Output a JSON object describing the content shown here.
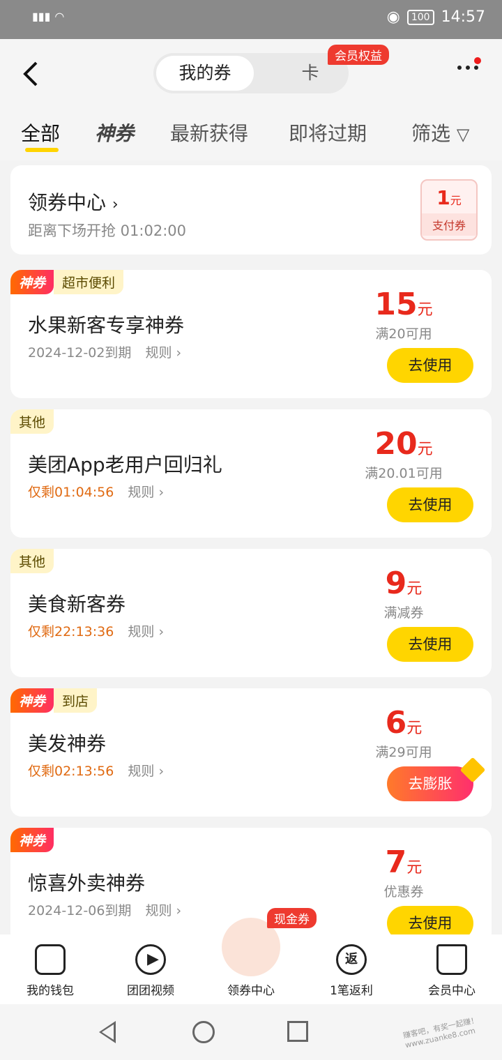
{
  "status": {
    "time": "14:57",
    "battery": "100"
  },
  "header": {
    "tab_active": "我的券",
    "tab_other": "卡",
    "vip_badge": "会员权益"
  },
  "filters": {
    "items": [
      "全部",
      "神券",
      "最新获得",
      "即将过期",
      "筛选"
    ]
  },
  "coupon_center": {
    "title": "领券中心",
    "subtitle": "距离下场开抢 01:02:00",
    "mini_amount": "1",
    "mini_unit": "元",
    "mini_label": "支付券"
  },
  "coupons": [
    {
      "tag_shen": "神券",
      "category": "超市便利",
      "name": "水果新客专享神券",
      "meta": "2024-12-02到期",
      "rule": "规则",
      "amount": "15",
      "unit": "元",
      "cond": "满20可用",
      "button": "去使用"
    },
    {
      "category": "其他",
      "name": "美团App老用户回归礼",
      "meta": "仅剩01:04:56",
      "rule": "规则",
      "amount": "20",
      "unit": "元",
      "cond": "满20.01可用",
      "button": "去使用"
    },
    {
      "category": "其他",
      "name": "美食新客券",
      "meta": "仅剩22:13:36",
      "rule": "规则",
      "amount": "9",
      "unit": "元",
      "cond": "满减券",
      "button": "去使用"
    },
    {
      "tag_shen": "神券",
      "category": "到店",
      "name": "美发神券",
      "meta": "仅剩02:13:56",
      "rule": "规则",
      "amount": "6",
      "unit": "元",
      "cond": "满29可用",
      "button": "去膨胀"
    },
    {
      "tag_shen": "神券",
      "name": "惊喜外卖神券",
      "meta": "2024-12-06到期",
      "rule": "规则",
      "amount": "7",
      "unit": "元",
      "cond": "优惠券",
      "button": "去使用"
    }
  ],
  "bottom_nav": {
    "wallet": "我的钱包",
    "video": "团团视频",
    "center": "领券中心",
    "cashback": "1笔返利",
    "vip": "会员中心",
    "cash_badge": "现金券",
    "cashback_icon": "返"
  },
  "watermark": "赚客吧，有奖一起赚！www.zuanke8.com"
}
